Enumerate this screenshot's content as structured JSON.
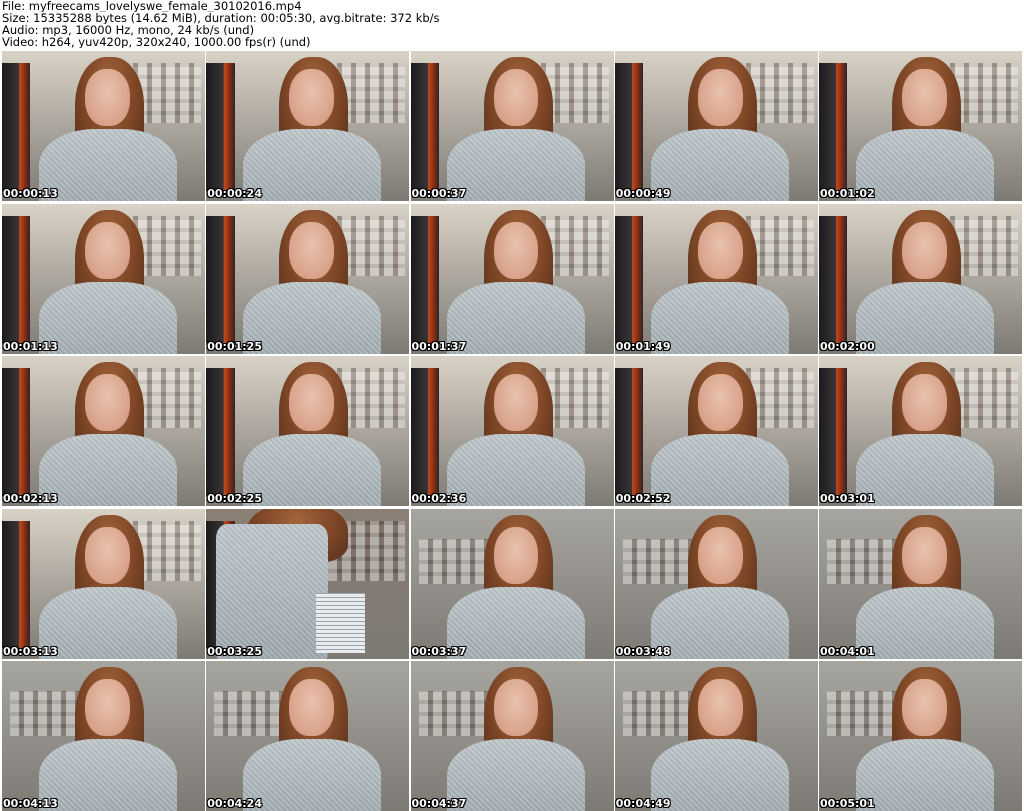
{
  "header": {
    "file_line": "File: myfreecams_lovelyswe_female_30102016.mp4",
    "size_line": "Size: 15335288 bytes (14.62 MiB), duration: 00:05:30, avg.bitrate: 372 kb/s",
    "audio_line": "Audio: mp3, 16000 Hz, mono, 24 kb/s (und)",
    "video_line": "Video: h264, yuv420p, 320x240, 1000.00 fps(r) (und)"
  },
  "frames": [
    {
      "timestamp": "00:00:13",
      "scene": "room"
    },
    {
      "timestamp": "00:00:24",
      "scene": "room"
    },
    {
      "timestamp": "00:00:37",
      "scene": "room"
    },
    {
      "timestamp": "00:00:49",
      "scene": "room"
    },
    {
      "timestamp": "00:01:02",
      "scene": "room"
    },
    {
      "timestamp": "00:01:13",
      "scene": "room"
    },
    {
      "timestamp": "00:01:25",
      "scene": "room"
    },
    {
      "timestamp": "00:01:37",
      "scene": "room"
    },
    {
      "timestamp": "00:01:49",
      "scene": "room"
    },
    {
      "timestamp": "00:02:00",
      "scene": "room"
    },
    {
      "timestamp": "00:02:13",
      "scene": "room"
    },
    {
      "timestamp": "00:02:25",
      "scene": "room"
    },
    {
      "timestamp": "00:02:36",
      "scene": "room"
    },
    {
      "timestamp": "00:02:52",
      "scene": "room"
    },
    {
      "timestamp": "00:03:01",
      "scene": "room"
    },
    {
      "timestamp": "00:03:13",
      "scene": "room"
    },
    {
      "timestamp": "00:03:25",
      "scene": "closeup"
    },
    {
      "timestamp": "00:03:37",
      "scene": "wall"
    },
    {
      "timestamp": "00:03:48",
      "scene": "wall"
    },
    {
      "timestamp": "00:04:01",
      "scene": "wall"
    },
    {
      "timestamp": "00:04:13",
      "scene": "wall"
    },
    {
      "timestamp": "00:04:24",
      "scene": "wall"
    },
    {
      "timestamp": "00:04:37",
      "scene": "wall"
    },
    {
      "timestamp": "00:04:49",
      "scene": "wall"
    },
    {
      "timestamp": "00:05:01",
      "scene": "wall"
    }
  ],
  "colors": {
    "room_wall": "#d9d2c6",
    "wall_scene": "#a7a59f",
    "closeup_bg": "#8b7f74"
  }
}
